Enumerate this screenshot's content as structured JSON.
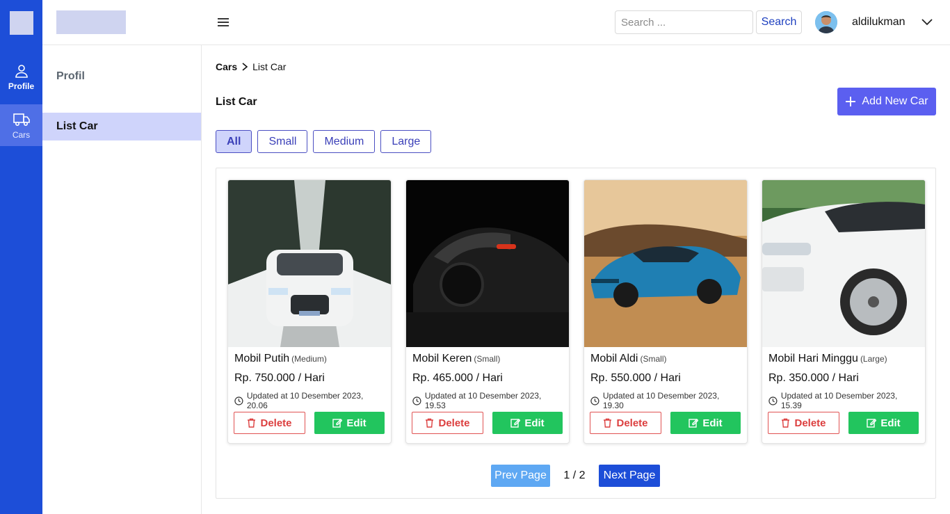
{
  "rail": {
    "items": [
      {
        "label": "Profile",
        "icon": "user-icon"
      },
      {
        "label": "Cars",
        "icon": "truck-icon"
      }
    ]
  },
  "header": {
    "search": {
      "placeholder": "Search ...",
      "value": ""
    },
    "search_button": "Search",
    "username": "aldilukman"
  },
  "subnav": {
    "title": "Profil",
    "items": [
      {
        "label": "List Car",
        "active": true
      }
    ]
  },
  "breadcrumb": [
    "Cars",
    "List Car"
  ],
  "page_title": "List Car",
  "add_button": "Add New Car",
  "filters": [
    {
      "label": "All",
      "active": true
    },
    {
      "label": "Small",
      "active": false
    },
    {
      "label": "Medium",
      "active": false
    },
    {
      "label": "Large",
      "active": false
    }
  ],
  "cars": [
    {
      "name": "Mobil Putih",
      "size": "(Medium)",
      "price": "Rp. 750.000 / Hari",
      "updated": "Updated at 10 Desember 2023, 20.06",
      "delete_label": "Delete",
      "edit_label": "Edit"
    },
    {
      "name": "Mobil Keren",
      "size": "(Small)",
      "price": "Rp. 465.000 / Hari",
      "updated": "Updated at 10 Desember 2023, 19.53",
      "delete_label": "Delete",
      "edit_label": "Edit"
    },
    {
      "name": "Mobil Aldi",
      "size": "(Small)",
      "price": "Rp. 550.000 / Hari",
      "updated": "Updated at 10 Desember 2023, 19.30",
      "delete_label": "Delete",
      "edit_label": "Edit"
    },
    {
      "name": "Mobil Hari Minggu",
      "size": "(Large)",
      "price": "Rp. 350.000 / Hari",
      "updated": "Updated at 10 Desember 2023, 15.39",
      "delete_label": "Delete",
      "edit_label": "Edit"
    }
  ],
  "pagination": {
    "prev": "Prev Page",
    "page": "1 / 2",
    "next": "Next Page"
  },
  "colors": {
    "primary": "#1d4ed8",
    "accent": "#5b5ff0",
    "success": "#22c55e",
    "danger": "#dc3e3e",
    "active_bg": "#cfd4fb"
  }
}
